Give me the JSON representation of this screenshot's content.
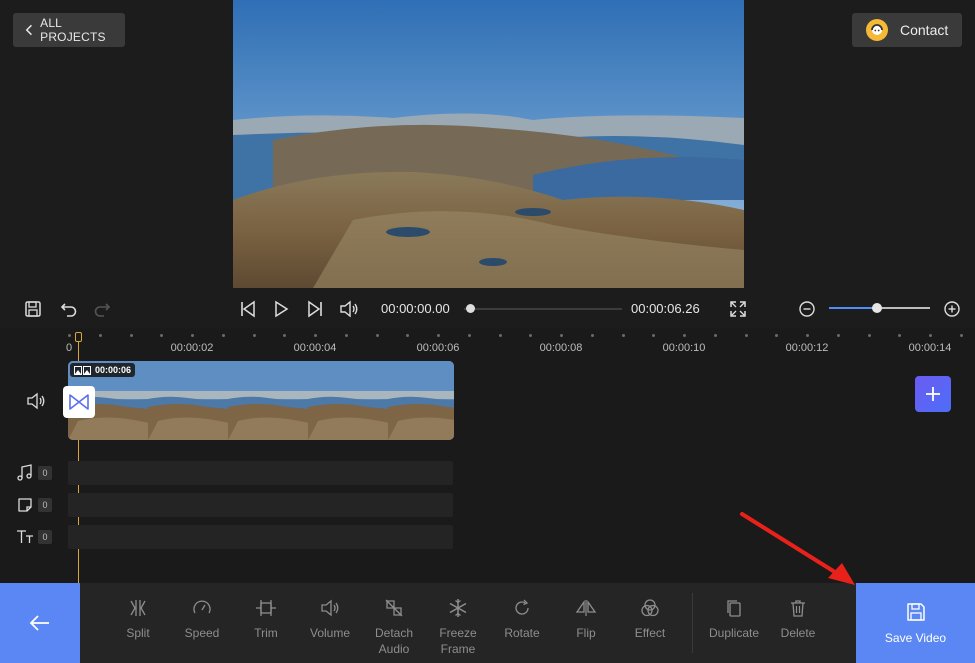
{
  "header": {
    "back_label": "ALL PROJECTS",
    "contact_label": "Contact"
  },
  "player": {
    "current_time": "00:00:00.00",
    "total_time": "00:00:06.26",
    "zoom_level": 0.48,
    "seek_progress": 0.0
  },
  "timeline": {
    "ruler_labels": [
      "0",
      "00:00:02",
      "00:00:04",
      "00:00:06",
      "00:00:08",
      "00:00:10",
      "00:00:12",
      "00:00:14"
    ],
    "clip_duration": "00:00:06",
    "tracks": [
      {
        "name": "music",
        "icon": "music-note-icon",
        "count": "0"
      },
      {
        "name": "sticker",
        "icon": "sticker-icon",
        "count": "0"
      },
      {
        "name": "text",
        "icon": "text-icon",
        "count": "0"
      }
    ]
  },
  "toolbar": {
    "tools": [
      {
        "id": "split",
        "label": "Split",
        "icon": "split-icon"
      },
      {
        "id": "speed",
        "label": "Speed",
        "icon": "speed-icon"
      },
      {
        "id": "trim",
        "label": "Trim",
        "icon": "trim-icon"
      },
      {
        "id": "volume",
        "label": "Volume",
        "icon": "volume-icon"
      },
      {
        "id": "detach-audio",
        "label": "Detach Audio",
        "icon": "detach-audio-icon"
      },
      {
        "id": "freeze-frame",
        "label": "Freeze Frame",
        "icon": "snowflake-icon"
      },
      {
        "id": "rotate",
        "label": "Rotate",
        "icon": "rotate-icon"
      },
      {
        "id": "flip",
        "label": "Flip",
        "icon": "flip-icon"
      },
      {
        "id": "effect",
        "label": "Effect",
        "icon": "effect-icon"
      },
      {
        "id": "duplicate",
        "label": "Duplicate",
        "icon": "duplicate-icon"
      },
      {
        "id": "delete",
        "label": "Delete",
        "icon": "trash-icon"
      }
    ],
    "save_label": "Save Video"
  },
  "colors": {
    "accent": "#5b87f5",
    "playhead": "#d9a63b",
    "annotation_arrow": "#e8221b"
  }
}
